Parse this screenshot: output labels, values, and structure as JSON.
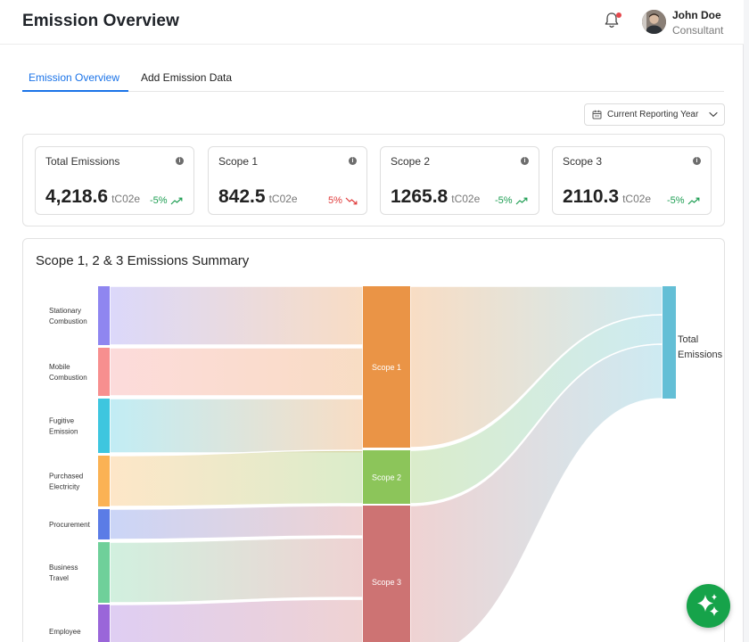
{
  "header": {
    "title": "Emission Overview",
    "user": {
      "name": "John Doe",
      "role": "Consultant"
    }
  },
  "tabs": [
    {
      "label": "Emission Overview",
      "active": true
    },
    {
      "label": "Add Emission Data",
      "active": false
    }
  ],
  "period_select": {
    "value": "Current Reporting Year"
  },
  "cards": [
    {
      "title": "Total Emissions",
      "value": "4,218.6",
      "unit": "tC02e",
      "delta": "-5%",
      "trend": "down"
    },
    {
      "title": "Scope 1",
      "value": "842.5",
      "unit": "tC02e",
      "delta": "5%",
      "trend": "up"
    },
    {
      "title": "Scope 2",
      "value": "1265.8",
      "unit": "tC02e",
      "delta": "-5%",
      "trend": "down"
    },
    {
      "title": "Scope 3",
      "value": "2110.3",
      "unit": "tC02e",
      "delta": "-5%",
      "trend": "down"
    }
  ],
  "summary": {
    "title": "Scope 1, 2 & 3 Emissions Summary",
    "sources": [
      {
        "label": "Stationary\nCombustion",
        "color": "#8f86f0"
      },
      {
        "label": "Mobile\nCombustion",
        "color": "#f78f8f"
      },
      {
        "label": "Fugitive\nEmission",
        "color": "#3ec6df"
      },
      {
        "label": "Purchased\nElectricity",
        "color": "#fbb254"
      },
      {
        "label": "Procurement",
        "color": "#5b7ce6"
      },
      {
        "label": "Business\nTravel",
        "color": "#6fd09a"
      },
      {
        "label": "Employee",
        "color": "#9a66d9"
      }
    ],
    "scopes": [
      {
        "label": "Scope 1",
        "color": "#ea9446"
      },
      {
        "label": "Scope 2",
        "color": "#8cc55a"
      },
      {
        "label": "Scope 3",
        "color": "#cd7373"
      }
    ],
    "target": {
      "label": "Total\nEmissions",
      "color": "#64bfd6"
    }
  },
  "colors": {
    "accent": "#1a73e8",
    "positive": "#1e9e53",
    "negative": "#e03b3b",
    "fab": "#16a34a"
  },
  "icons": {
    "bell": "bell-icon",
    "info": "info-icon",
    "calendar": "calendar-icon",
    "chevron": "chevron-down-icon",
    "trend_down": "trend-down-icon",
    "trend_up": "trend-up-icon",
    "assistant": "sparkles-icon"
  }
}
